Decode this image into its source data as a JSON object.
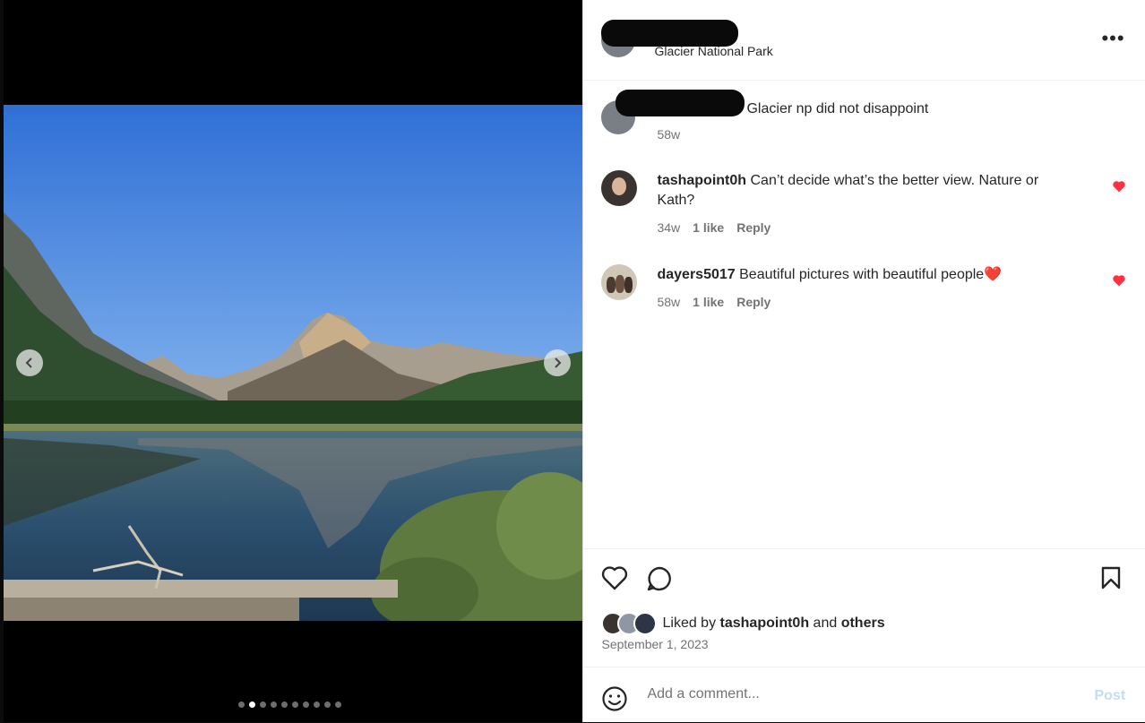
{
  "post": {
    "location": "Glacier National Park",
    "caption": "Glacier np did not disappoint",
    "caption_time": "58w",
    "photo_count": 10,
    "active_photo_index": 1
  },
  "comments": [
    {
      "username": "tashapoint0h",
      "text": "Can’t decide what’s the better view. Nature or Kath?",
      "time": "34w",
      "likes": "1 like",
      "reply": "Reply"
    },
    {
      "username": "dayers5017",
      "text": "Beautiful pictures with beautiful people",
      "emoji": "❤️",
      "time": "58w",
      "likes": "1 like",
      "reply": "Reply"
    }
  ],
  "likes_summary": {
    "prefix": "Liked by",
    "user": "tashapoint0h",
    "conjunction": "and",
    "others": "others"
  },
  "date": "September 1, 2023",
  "composer": {
    "placeholder": "Add a comment...",
    "post_label": "Post"
  },
  "colors": {
    "like_red": "#ff3040",
    "post_disabled": "#c3dbf7"
  }
}
